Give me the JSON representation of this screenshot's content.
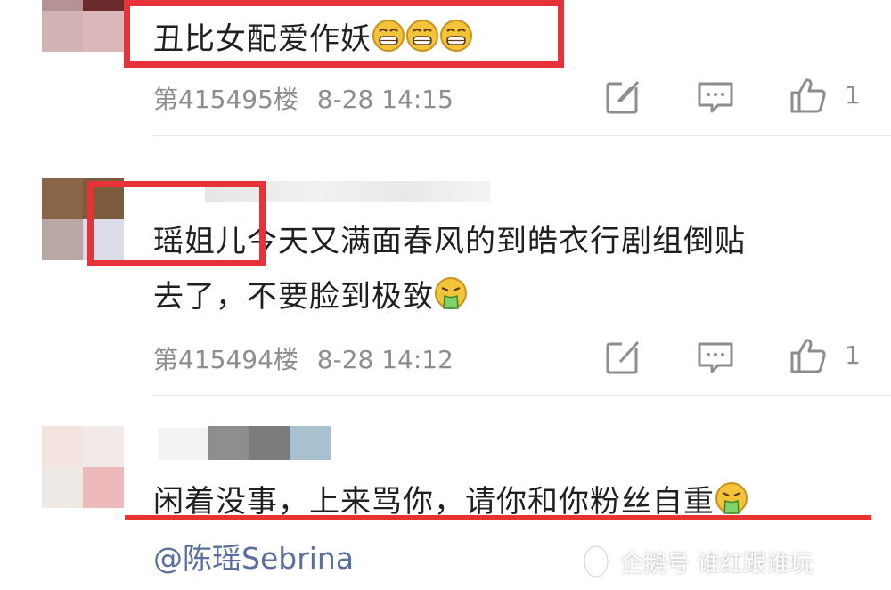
{
  "comments": [
    {
      "text": "丑比女配爱作妖",
      "floor": "第415495楼",
      "time": "8-28 14:15",
      "likes": "1",
      "emoji": "grin-emoji"
    },
    {
      "text_line1": "瑶姐儿今天又满面春风的到皓衣行剧组倒贴",
      "text_line2": "去了，不要脸到极致",
      "floor": "第415494楼",
      "time": "8-28 14:12",
      "likes": "1",
      "emoji": "vomit-emoji"
    },
    {
      "text": "闲着没事，上来骂你，请你和你粉丝自重",
      "mention": "@陈瑶Sebrina",
      "emoji": "vomit-emoji"
    }
  ],
  "watermark": "企鹅号 谁红跟谁玩",
  "colors": {
    "highlight_red": "#e8323a",
    "meta_gray": "#8d8d8d",
    "mention_blue": "#5a6f9e"
  },
  "icons": [
    "edit-icon",
    "comment-icon",
    "thumbs-up-icon"
  ]
}
